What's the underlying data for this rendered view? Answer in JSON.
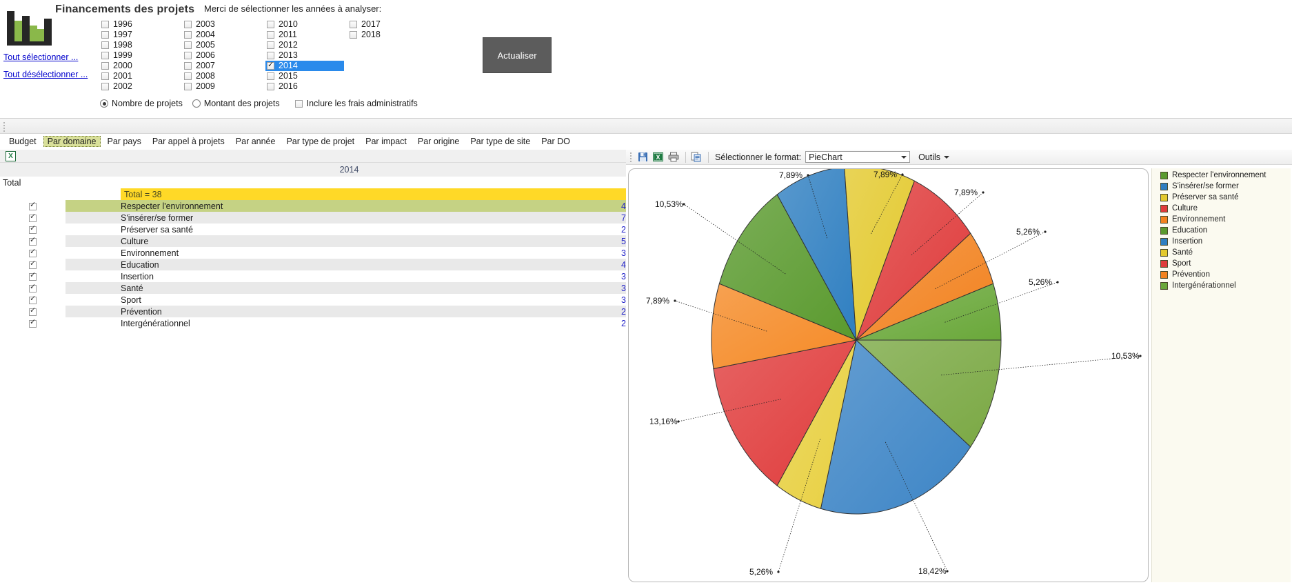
{
  "app": {
    "title": "Financements des projets",
    "logo_icon": "bar-chart-logo-icon",
    "select_all_label": "Tout sélectionner ...",
    "deselect_all_label": "Tout désélectionner ...",
    "years_caption": "Merci de sélectionner les années à analyser:",
    "refresh_label": "Actualiser"
  },
  "years": [
    {
      "label": "1996",
      "checked": false
    },
    {
      "label": "1997",
      "checked": false
    },
    {
      "label": "1998",
      "checked": false
    },
    {
      "label": "1999",
      "checked": false
    },
    {
      "label": "2000",
      "checked": false
    },
    {
      "label": "2001",
      "checked": false
    },
    {
      "label": "2002",
      "checked": false
    },
    {
      "label": "2003",
      "checked": false
    },
    {
      "label": "2004",
      "checked": false
    },
    {
      "label": "2005",
      "checked": false
    },
    {
      "label": "2006",
      "checked": false
    },
    {
      "label": "2007",
      "checked": false
    },
    {
      "label": "2008",
      "checked": false
    },
    {
      "label": "2009",
      "checked": false
    },
    {
      "label": "2010",
      "checked": false
    },
    {
      "label": "2011",
      "checked": false
    },
    {
      "label": "2012",
      "checked": false
    },
    {
      "label": "2013",
      "checked": false
    },
    {
      "label": "2014",
      "checked": true
    },
    {
      "label": "2015",
      "checked": false
    },
    {
      "label": "2016",
      "checked": false
    },
    {
      "label": "2017",
      "checked": false
    },
    {
      "label": "2018",
      "checked": false
    }
  ],
  "options": {
    "count_label": "Nombre de projets",
    "count_selected": true,
    "amount_label": "Montant des projets",
    "amount_selected": false,
    "admin_fees_label": "Inclure les frais administratifs",
    "admin_fees_checked": false
  },
  "tabs": [
    {
      "label": "Budget",
      "active": false
    },
    {
      "label": "Par domaine",
      "active": true
    },
    {
      "label": "Par pays",
      "active": false
    },
    {
      "label": "Par appel à projets",
      "active": false
    },
    {
      "label": "Par année",
      "active": false
    },
    {
      "label": "Par type de projet",
      "active": false
    },
    {
      "label": "Par impact",
      "active": false
    },
    {
      "label": "Par origine",
      "active": false
    },
    {
      "label": "Par type de site",
      "active": false
    },
    {
      "label": "Par DO",
      "active": false
    }
  ],
  "grid": {
    "export_icon": "excel-export-icon",
    "excel_glyph": "X",
    "column_header": "2014",
    "total_row_label": "Total",
    "total_value_label": "Total = 38",
    "rows": [
      {
        "label": "Respecter l'environnement",
        "value": "4",
        "checked": true
      },
      {
        "label": "S'insérer/se former",
        "value": "7",
        "checked": true
      },
      {
        "label": "Préserver sa santé",
        "value": "2",
        "checked": true
      },
      {
        "label": "Culture",
        "value": "5",
        "checked": true
      },
      {
        "label": "Environnement",
        "value": "3",
        "checked": true
      },
      {
        "label": "Education",
        "value": "4",
        "checked": true
      },
      {
        "label": "Insertion",
        "value": "3",
        "checked": true
      },
      {
        "label": "Santé",
        "value": "3",
        "checked": true
      },
      {
        "label": "Sport",
        "value": "3",
        "checked": true
      },
      {
        "label": "Prévention",
        "value": "2",
        "checked": true
      },
      {
        "label": "Intergénérationnel",
        "value": "2",
        "checked": true
      }
    ]
  },
  "chart_toolbar": {
    "save_icon": "save-disk-icon",
    "excel_icon": "excel-export-icon",
    "print_icon": "print-icon",
    "copy_icon": "copy-icon",
    "format_label": "Sélectionner le format:",
    "format_value": "PieChart",
    "format_options": [
      "PieChart"
    ],
    "tools_label": "Outils"
  },
  "chart_data": {
    "type": "pie",
    "title": "",
    "legend_position": "right",
    "labels": [
      "Respecter l'environnement",
      "S'insérer/se former",
      "Préserver sa santé",
      "Culture",
      "Environnement",
      "Education",
      "Insertion",
      "Santé",
      "Sport",
      "Prévention",
      "Intergénérationnel"
    ],
    "values": [
      4,
      7,
      2,
      5,
      3,
      4,
      3,
      3,
      3,
      2,
      2
    ],
    "total": 38,
    "percent_labels": [
      "10,53%",
      "18,42%",
      "5,26%",
      "13,16%",
      "7,89%",
      "10,53%",
      "7,89%",
      "7,89%",
      "7,89%",
      "5,26%",
      "5,26%"
    ],
    "colors": [
      "#7aa843",
      "#3d85c6",
      "#e8d040",
      "#e03c3c",
      "#f58a26",
      "#5a9a2e",
      "#2f7fc1",
      "#e3c92d",
      "#df3b3b",
      "#f2821f",
      "#6aa83a"
    ],
    "legend_colors": [
      "#5a9a2e",
      "#2f7fc1",
      "#e3c92d",
      "#df3b3b",
      "#f2821f",
      "#5a9a2e",
      "#2f7fc1",
      "#e3c92d",
      "#df3b3b",
      "#f2821f",
      "#6aa83a"
    ]
  }
}
